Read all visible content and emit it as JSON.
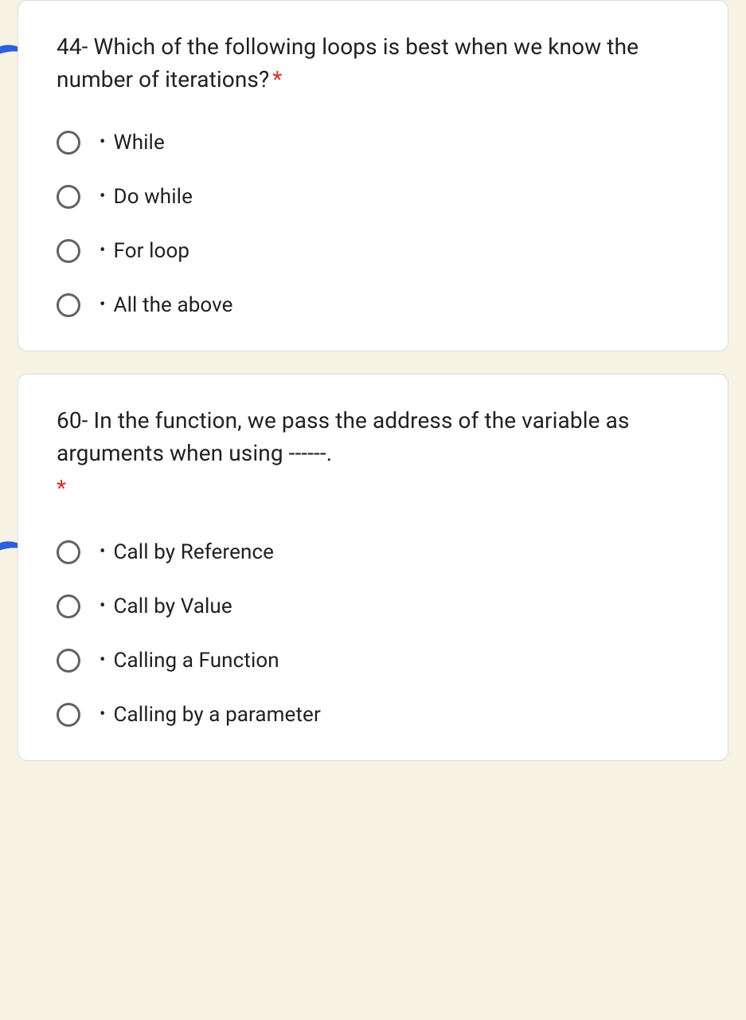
{
  "required_marker": "*",
  "questions": [
    {
      "text": "44- Which of the following loops is best when we know the number of iterations?",
      "required": true,
      "options": [
        "While",
        "Do while",
        "For loop",
        "All the above"
      ]
    },
    {
      "text": "60- In the function, we pass the address of the variable as arguments when using ------.",
      "required": true,
      "options": [
        "Call by Reference",
        "Call by Value",
        "Calling a Function",
        "Calling by a parameter"
      ]
    }
  ]
}
